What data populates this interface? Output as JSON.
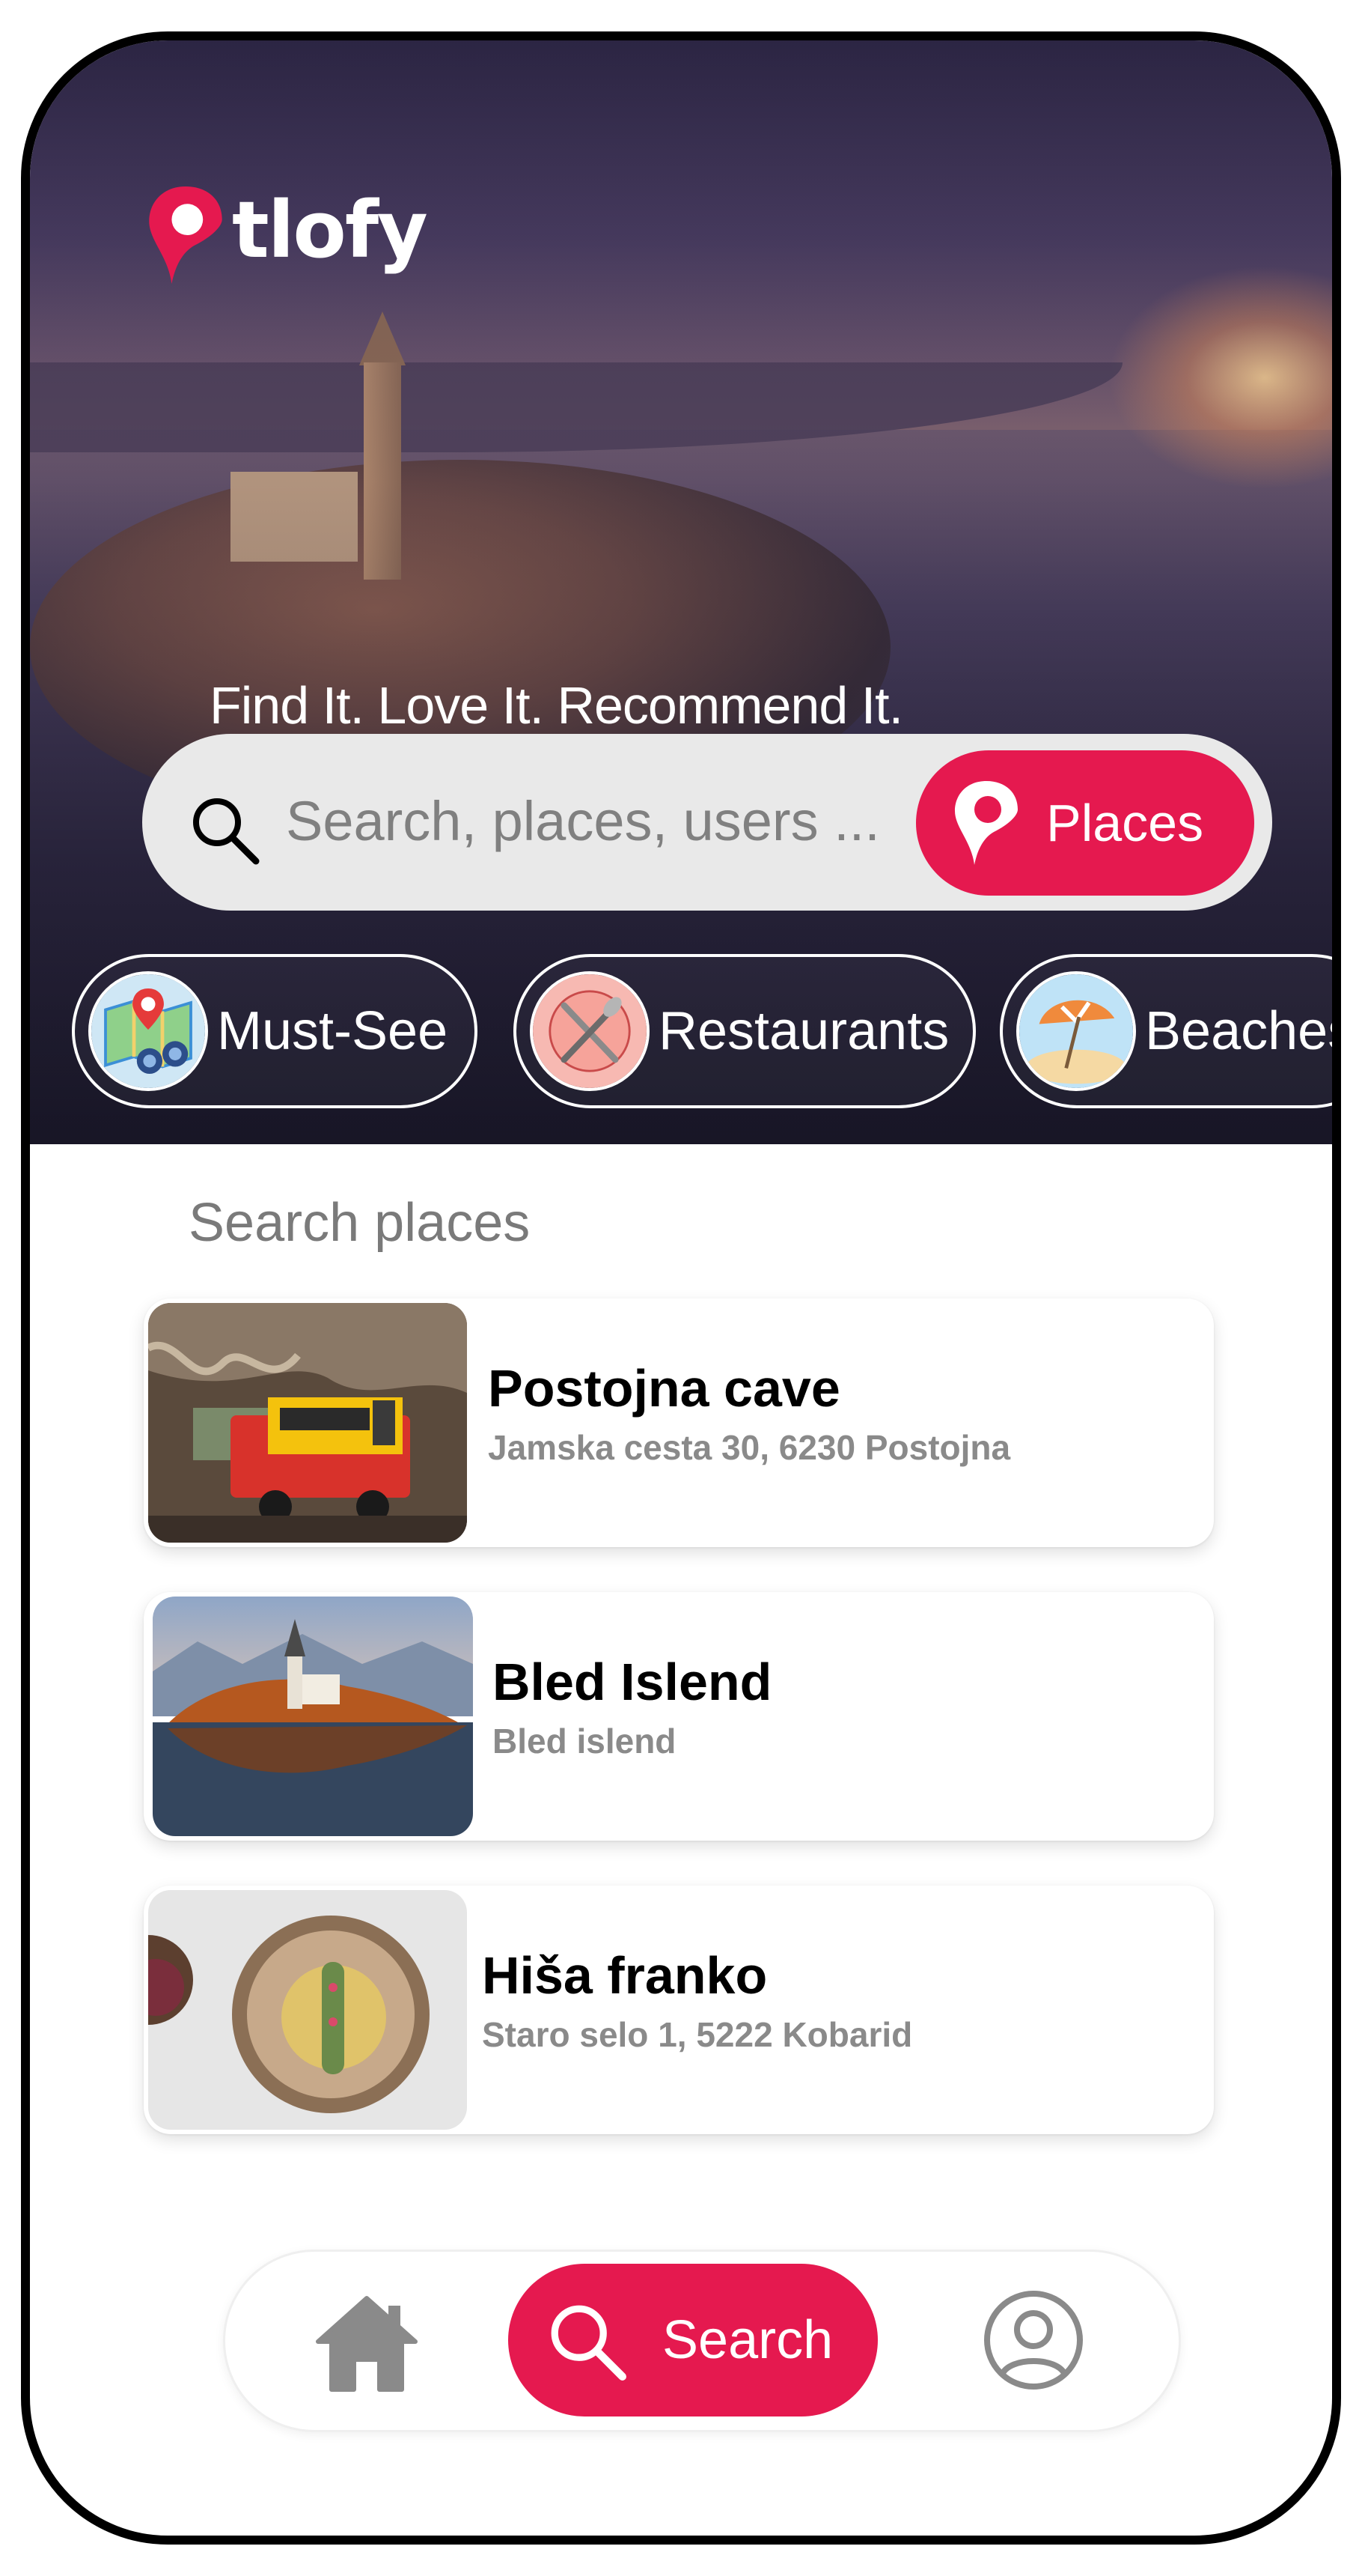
{
  "app": {
    "logo_text": "tlofy",
    "tagline": "Find It. Love It. Recommend It."
  },
  "colors": {
    "accent": "#e5194f",
    "text_muted": "#8a8a8a",
    "section_title": "#7a7a7a"
  },
  "search": {
    "placeholder": "Search, places, users ...",
    "value": "",
    "mode_button_label": "Places"
  },
  "categories": [
    {
      "label": "Must-See",
      "icon": "map-binoculars-icon"
    },
    {
      "label": "Restaurants",
      "icon": "fork-knife-icon"
    },
    {
      "label": "Beaches",
      "icon": "beach-umbrella-icon"
    }
  ],
  "results": {
    "title": "Search places",
    "items": [
      {
        "name": "Postojna cave",
        "address": "Jamska cesta 30, 6230 Postojna",
        "thumb": "cave-train-photo"
      },
      {
        "name": "Bled Islend",
        "address": "Bled islend",
        "thumb": "lake-bled-photo"
      },
      {
        "name": "Hiša franko",
        "address": "Staro selo 1, 5222 Kobarid",
        "thumb": "plated-dish-photo"
      }
    ]
  },
  "nav": {
    "home_icon": "home-icon",
    "search_label": "Search",
    "profile_icon": "user-icon"
  }
}
